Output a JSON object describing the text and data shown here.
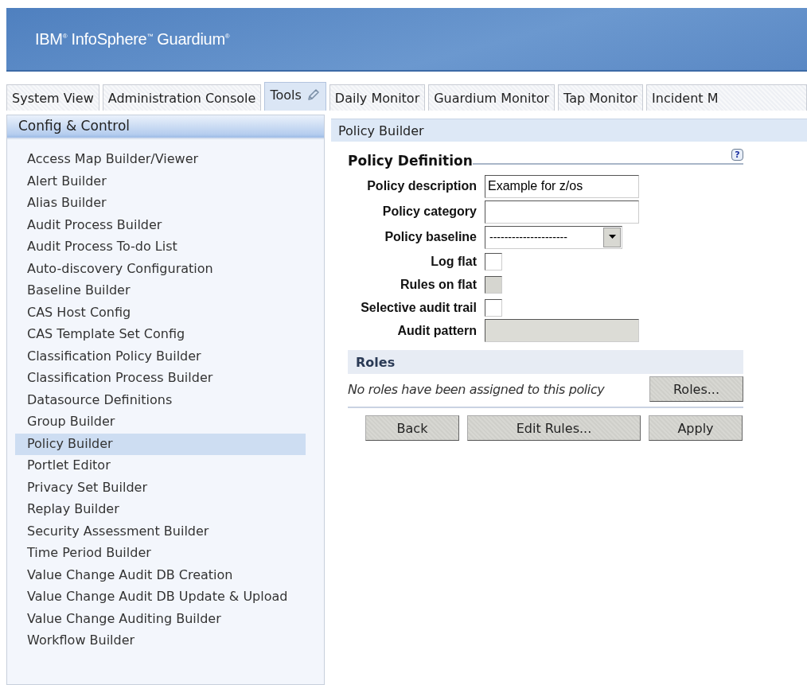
{
  "banner": {
    "logo": "IBM$^{®}$ InfoSphere$^{™}$ Guardium$^{®}$"
  },
  "tabs": [
    {
      "label": "System View",
      "selected": false,
      "icon": false
    },
    {
      "label": "Administration Console",
      "selected": false,
      "icon": false
    },
    {
      "label": "Tools",
      "selected": true,
      "icon": true
    },
    {
      "label": "Daily Monitor",
      "selected": false,
      "icon": false
    },
    {
      "label": "Guardium Monitor",
      "selected": false,
      "icon": false
    },
    {
      "label": "Tap Monitor",
      "selected": false,
      "icon": false
    },
    {
      "label": "Incident M",
      "selected": false,
      "icon": false
    }
  ],
  "sidebar": {
    "title": "Config & Control",
    "items": [
      {
        "label": "Access Map Builder/Viewer",
        "selected": false
      },
      {
        "label": "Alert Builder",
        "selected": false
      },
      {
        "label": "Alias Builder",
        "selected": false
      },
      {
        "label": "Audit Process Builder",
        "selected": false
      },
      {
        "label": "Audit Process To-do List",
        "selected": false
      },
      {
        "label": "Auto-discovery Configuration",
        "selected": false
      },
      {
        "label": "Baseline Builder",
        "selected": false
      },
      {
        "label": "CAS Host Config",
        "selected": false
      },
      {
        "label": "CAS Template Set Config",
        "selected": false
      },
      {
        "label": "Classification Policy Builder",
        "selected": false
      },
      {
        "label": "Classification Process Builder",
        "selected": false
      },
      {
        "label": "Datasource Definitions",
        "selected": false
      },
      {
        "label": "Group Builder",
        "selected": false
      },
      {
        "label": "Policy Builder",
        "selected": true
      },
      {
        "label": "Portlet Editor",
        "selected": false
      },
      {
        "label": "Privacy Set Builder",
        "selected": false
      },
      {
        "label": "Replay Builder",
        "selected": false
      },
      {
        "label": "Security Assessment Builder",
        "selected": false
      },
      {
        "label": "Time Period Builder",
        "selected": false
      },
      {
        "label": "Value Change Audit DB Creation",
        "selected": false
      },
      {
        "label": "Value Change Audit DB Update & Upload",
        "selected": false
      },
      {
        "label": "Value Change Auditing Builder",
        "selected": false
      },
      {
        "label": "Workflow Builder",
        "selected": false
      }
    ]
  },
  "panel": {
    "title": "Policy Builder",
    "section": "Policy Definition",
    "help": "?",
    "fields": [
      {
        "kind": "text",
        "label": "Policy description",
        "value": "Example for z/os",
        "disabled": false
      },
      {
        "kind": "text",
        "label": "Policy category",
        "disabled": false
      },
      {
        "kind": "select",
        "label": "Policy baseline",
        "value": "---------------------",
        "disabled": false
      },
      {
        "kind": "checkbox",
        "label": "Log flat",
        "checked": false,
        "disabled": false
      },
      {
        "kind": "checkbox",
        "label": "Rules on flat",
        "checked": false,
        "disabled": true
      },
      {
        "kind": "checkbox",
        "label": "Selective audit trail",
        "checked": false,
        "disabled": false
      },
      {
        "kind": "text",
        "label": "Audit pattern",
        "disabled": true
      }
    ],
    "roles": {
      "title": "Roles",
      "message": "No roles have been assigned to this policy",
      "button": "Roles..."
    },
    "buttons": [
      "Back",
      "Edit Rules...",
      "Apply"
    ]
  }
}
